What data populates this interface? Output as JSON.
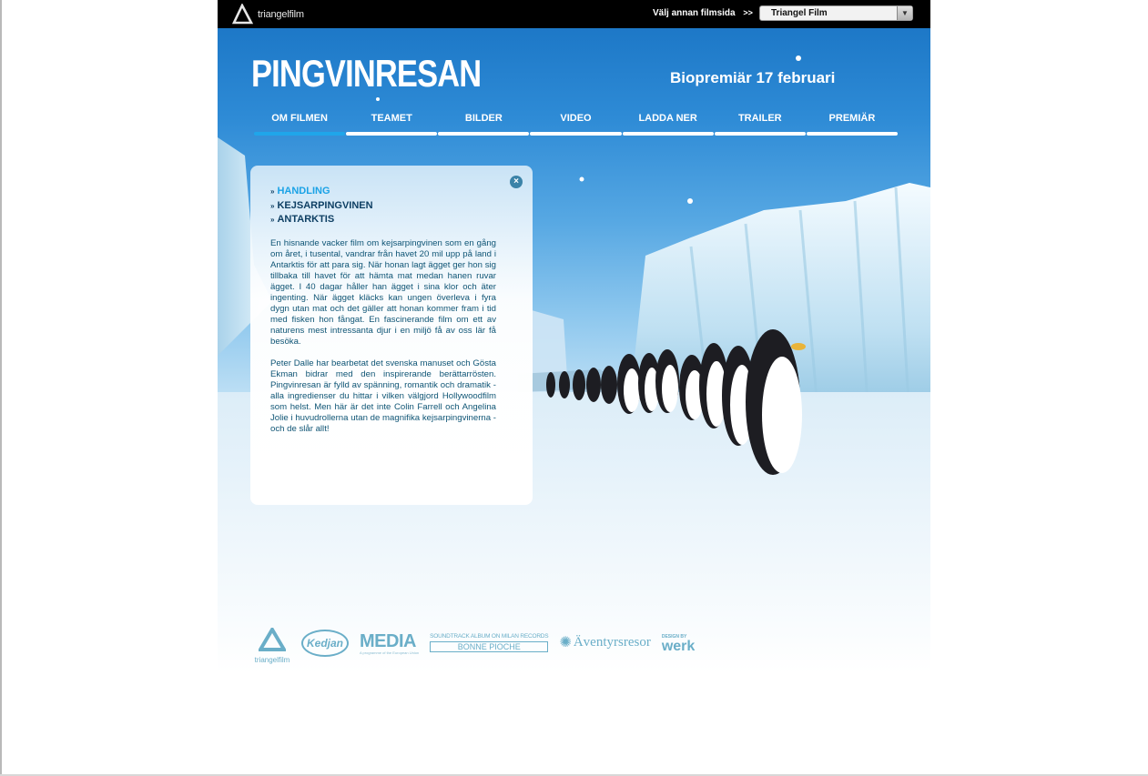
{
  "topbar": {
    "brand_name": "triangelfilm",
    "choose_label": "Välj annan filmsida",
    "choose_arrows": ">>",
    "select_value": "Triangel Film"
  },
  "hero": {
    "title": "PINGVINRESAN",
    "premiere": "Biopremiär 17 februari"
  },
  "nav": {
    "items": [
      "OM FILMEN",
      "TEAMET",
      "BILDER",
      "VIDEO",
      "LADDA NER",
      "TRAILER",
      "PREMIÄR"
    ],
    "active_index": 0
  },
  "panel": {
    "close_icon": "close-icon",
    "links": [
      "HANDLING",
      "KEJSARPINGVINEN",
      "ANTARKTIS"
    ],
    "active_link": 0,
    "paragraphs": [
      "En hisnande vacker film om kejsarpingvinen som en gång om året, i tusental, vandrar från havet 20 mil upp på land i Antarktis för att para sig. När honan lagt ägget ger hon sig tillbaka till havet för att hämta mat medan hanen ruvar ägget. I 40 dagar håller han ägget i sina klor och äter ingenting. När ägget kläcks kan ungen överleva i fyra dygn utan mat och det gäller att honan kommer fram i tid med fisken hon fångat. En fascinerande film om ett av naturens mest intressanta djur i en miljö få av oss lär få besöka.",
      "Peter Dalle har bearbetat det svenska manuset och Gösta Ekman bidrar med den inspirerande berättarrösten. Pingvinresan är fylld av spänning, romantik och dramatik - alla ingredienser du hittar i vilken välgjord Hollywoodfilm som helst. Men här är det inte Colin Farrell och Angelina Jolie i huvudrollerna utan de magnifika kejsarpingvinerna - och de slår allt!"
    ]
  },
  "logos": {
    "triangelfilm": "triangelfilm",
    "kedjan": "Kedjan",
    "media": "MEDIA",
    "media_sub": "A programme of the European Union",
    "soundtrack": "SOUNDTRACK ALBUM ON MILAN RECORDS",
    "bonne_pioche": "BONNE PIOCHE",
    "aventyrsresor": "Äventyrsresor",
    "design_by": "DESIGN BY",
    "werk": "werk"
  },
  "colors": {
    "accent": "#1aa2e6",
    "dark_text": "#0e3f63",
    "body_text": "#0f5575",
    "topbar": "#000000"
  }
}
